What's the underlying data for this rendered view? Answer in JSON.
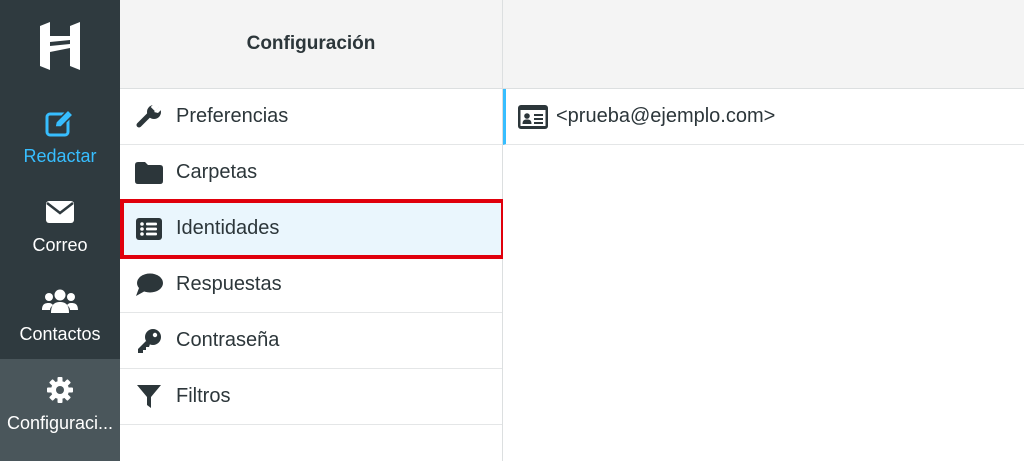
{
  "nav": {
    "items": [
      {
        "label": "Redactar",
        "icon": "compose-icon",
        "color": "#37beff"
      },
      {
        "label": "Correo",
        "icon": "envelope-icon"
      },
      {
        "label": "Contactos",
        "icon": "users-icon"
      },
      {
        "label": "Configuraci...",
        "icon": "gear-icon",
        "active": true
      }
    ]
  },
  "settings": {
    "title": "Configuración",
    "items": [
      {
        "label": "Preferencias",
        "icon": "wrench-icon"
      },
      {
        "label": "Carpetas",
        "icon": "folder-icon"
      },
      {
        "label": "Identidades",
        "icon": "list-icon",
        "selected": true
      },
      {
        "label": "Respuestas",
        "icon": "comment-icon"
      },
      {
        "label": "Contraseña",
        "icon": "key-icon"
      },
      {
        "label": "Filtros",
        "icon": "filter-icon"
      }
    ]
  },
  "identities": {
    "items": [
      {
        "label": "<prueba@ejemplo.com>",
        "icon": "id-card-icon"
      }
    ]
  },
  "colors": {
    "rail": "#2f3a3f",
    "accent": "#37beff",
    "highlight_border": "#e0000c",
    "selected_bg": "#eaf6fd"
  }
}
